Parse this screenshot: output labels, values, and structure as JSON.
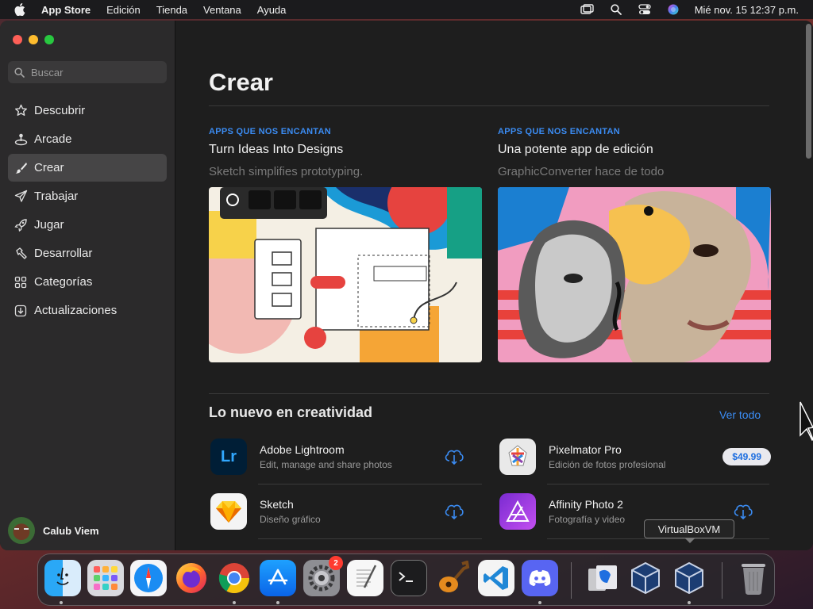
{
  "menubar": {
    "app": "App Store",
    "menus": [
      "Edición",
      "Tienda",
      "Ventana",
      "Ayuda"
    ],
    "clock": "Mié nov. 15 12:37 p.m.",
    "status_icons": [
      "screen-mirroring-icon",
      "spotlight-search-icon",
      "control-center-icon",
      "siri-icon"
    ]
  },
  "sidebar": {
    "search_placeholder": "Buscar",
    "items": [
      {
        "label": "Descubrir",
        "icon": "star-icon"
      },
      {
        "label": "Arcade",
        "icon": "joystick-icon"
      },
      {
        "label": "Crear",
        "icon": "paintbrush-icon",
        "active": true
      },
      {
        "label": "Trabajar",
        "icon": "paperplane-icon"
      },
      {
        "label": "Jugar",
        "icon": "rocket-icon"
      },
      {
        "label": "Desarrollar",
        "icon": "hammer-icon"
      },
      {
        "label": "Categorías",
        "icon": "grid-icon"
      },
      {
        "label": "Actualizaciones",
        "icon": "download-icon"
      }
    ],
    "user": "Calub Viem"
  },
  "main": {
    "title": "Crear",
    "features": [
      {
        "kicker": "APPS QUE NOS ENCANTAN",
        "title": "Turn Ideas Into Designs",
        "subtitle": "Sketch simplifies prototyping."
      },
      {
        "kicker": "APPS QUE NOS ENCANTAN",
        "title": "Una potente app de edición",
        "subtitle": "GraphicConverter hace de todo"
      }
    ],
    "section_title": "Lo nuevo en creatividad",
    "see_all": "Ver todo",
    "apps": [
      {
        "name": "Adobe Lightroom",
        "desc": "Edit, manage and share photos",
        "action": "cloud-download-icon",
        "icon_text": "Lr"
      },
      {
        "name": "Pixelmator Pro",
        "desc": "Edición de fotos profesional",
        "price": "$49.99"
      },
      {
        "name": "Sketch",
        "desc": "Diseño gráfico",
        "action": "cloud-download-icon"
      },
      {
        "name": "Affinity Photo 2",
        "desc": "Fotografía y video",
        "action": "cloud-download-icon"
      }
    ]
  },
  "tooltip": "VirtualBoxVM",
  "dock": {
    "apps": [
      "Finder",
      "Launchpad",
      "Safari",
      "Firefox",
      "Chrome",
      "App Store",
      "Configuración del Sistema",
      "TextEdit",
      "Terminal",
      "GarageBand",
      "Visual Studio Code",
      "Discord",
      "Vista previa",
      "VirtualBox",
      "VirtualBoxVM",
      "Papelera"
    ],
    "settings_badge": "2"
  },
  "colors": {
    "accent": "#3b8cf3",
    "sidebar_bg": "#2b2a2b",
    "content_bg": "#1e1e1e"
  }
}
